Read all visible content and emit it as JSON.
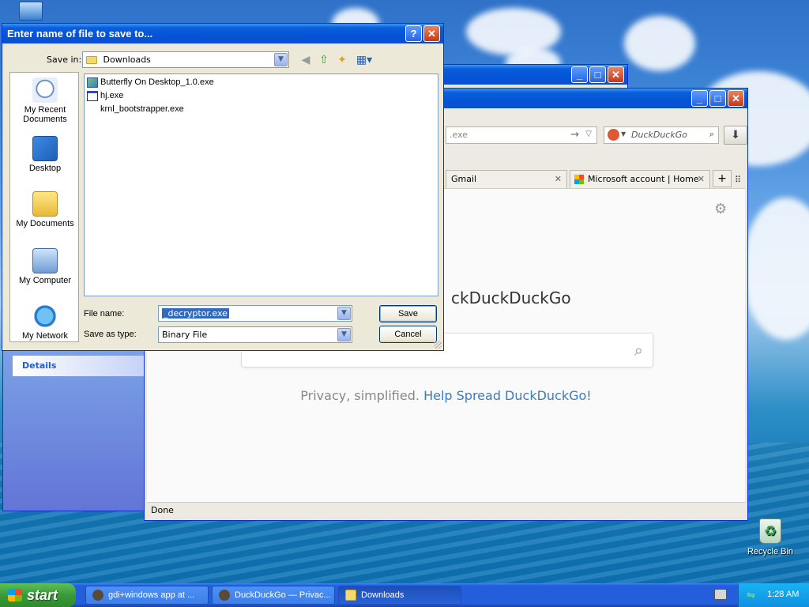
{
  "dialog": {
    "title": "Enter name of file to save to...",
    "help_glyph": "?",
    "close_glyph": "✕",
    "save_in_label": "Save in:",
    "save_in_value": "Downloads",
    "places": [
      "My Recent Documents",
      "Desktop",
      "My Documents",
      "My Computer",
      "My Network"
    ],
    "files": [
      "Butterfly On Desktop_1.0.exe",
      "hj.exe",
      "krnl_bootstrapper.exe"
    ],
    "file_name_label": "File name:",
    "file_name_value": "_decryptor.exe",
    "save_as_type_label": "Save as type:",
    "save_as_type_value": "Binary File",
    "save_button": "Save",
    "cancel_button": "Cancel"
  },
  "browser": {
    "url_text": ".exe",
    "search_placeholder": "DuckDuckGo",
    "tabs": [
      {
        "label": "Gmail"
      },
      {
        "label": "Microsoft account | Home"
      }
    ],
    "tab_close_glyph": "✕",
    "newtab_glyph": "+",
    "brand_text": "ckDuckDuckGo",
    "tagline": "Privacy, simplified.",
    "tagline_link": "Help Spread DuckDuckGo!",
    "status": "Done",
    "min_glyph": "_",
    "max_glyph": "□",
    "close_glyph": "✕"
  },
  "explorer": {
    "details_label": "Details"
  },
  "desktop": {
    "recycle_bin_label": "Recycle Bin"
  },
  "taskbar": {
    "start_label": "start",
    "tasks": [
      {
        "label": "gdi+windows app at ..."
      },
      {
        "label": "DuckDuckGo — Privac..."
      },
      {
        "label": "Downloads"
      }
    ],
    "clock": "1:28 AM"
  }
}
